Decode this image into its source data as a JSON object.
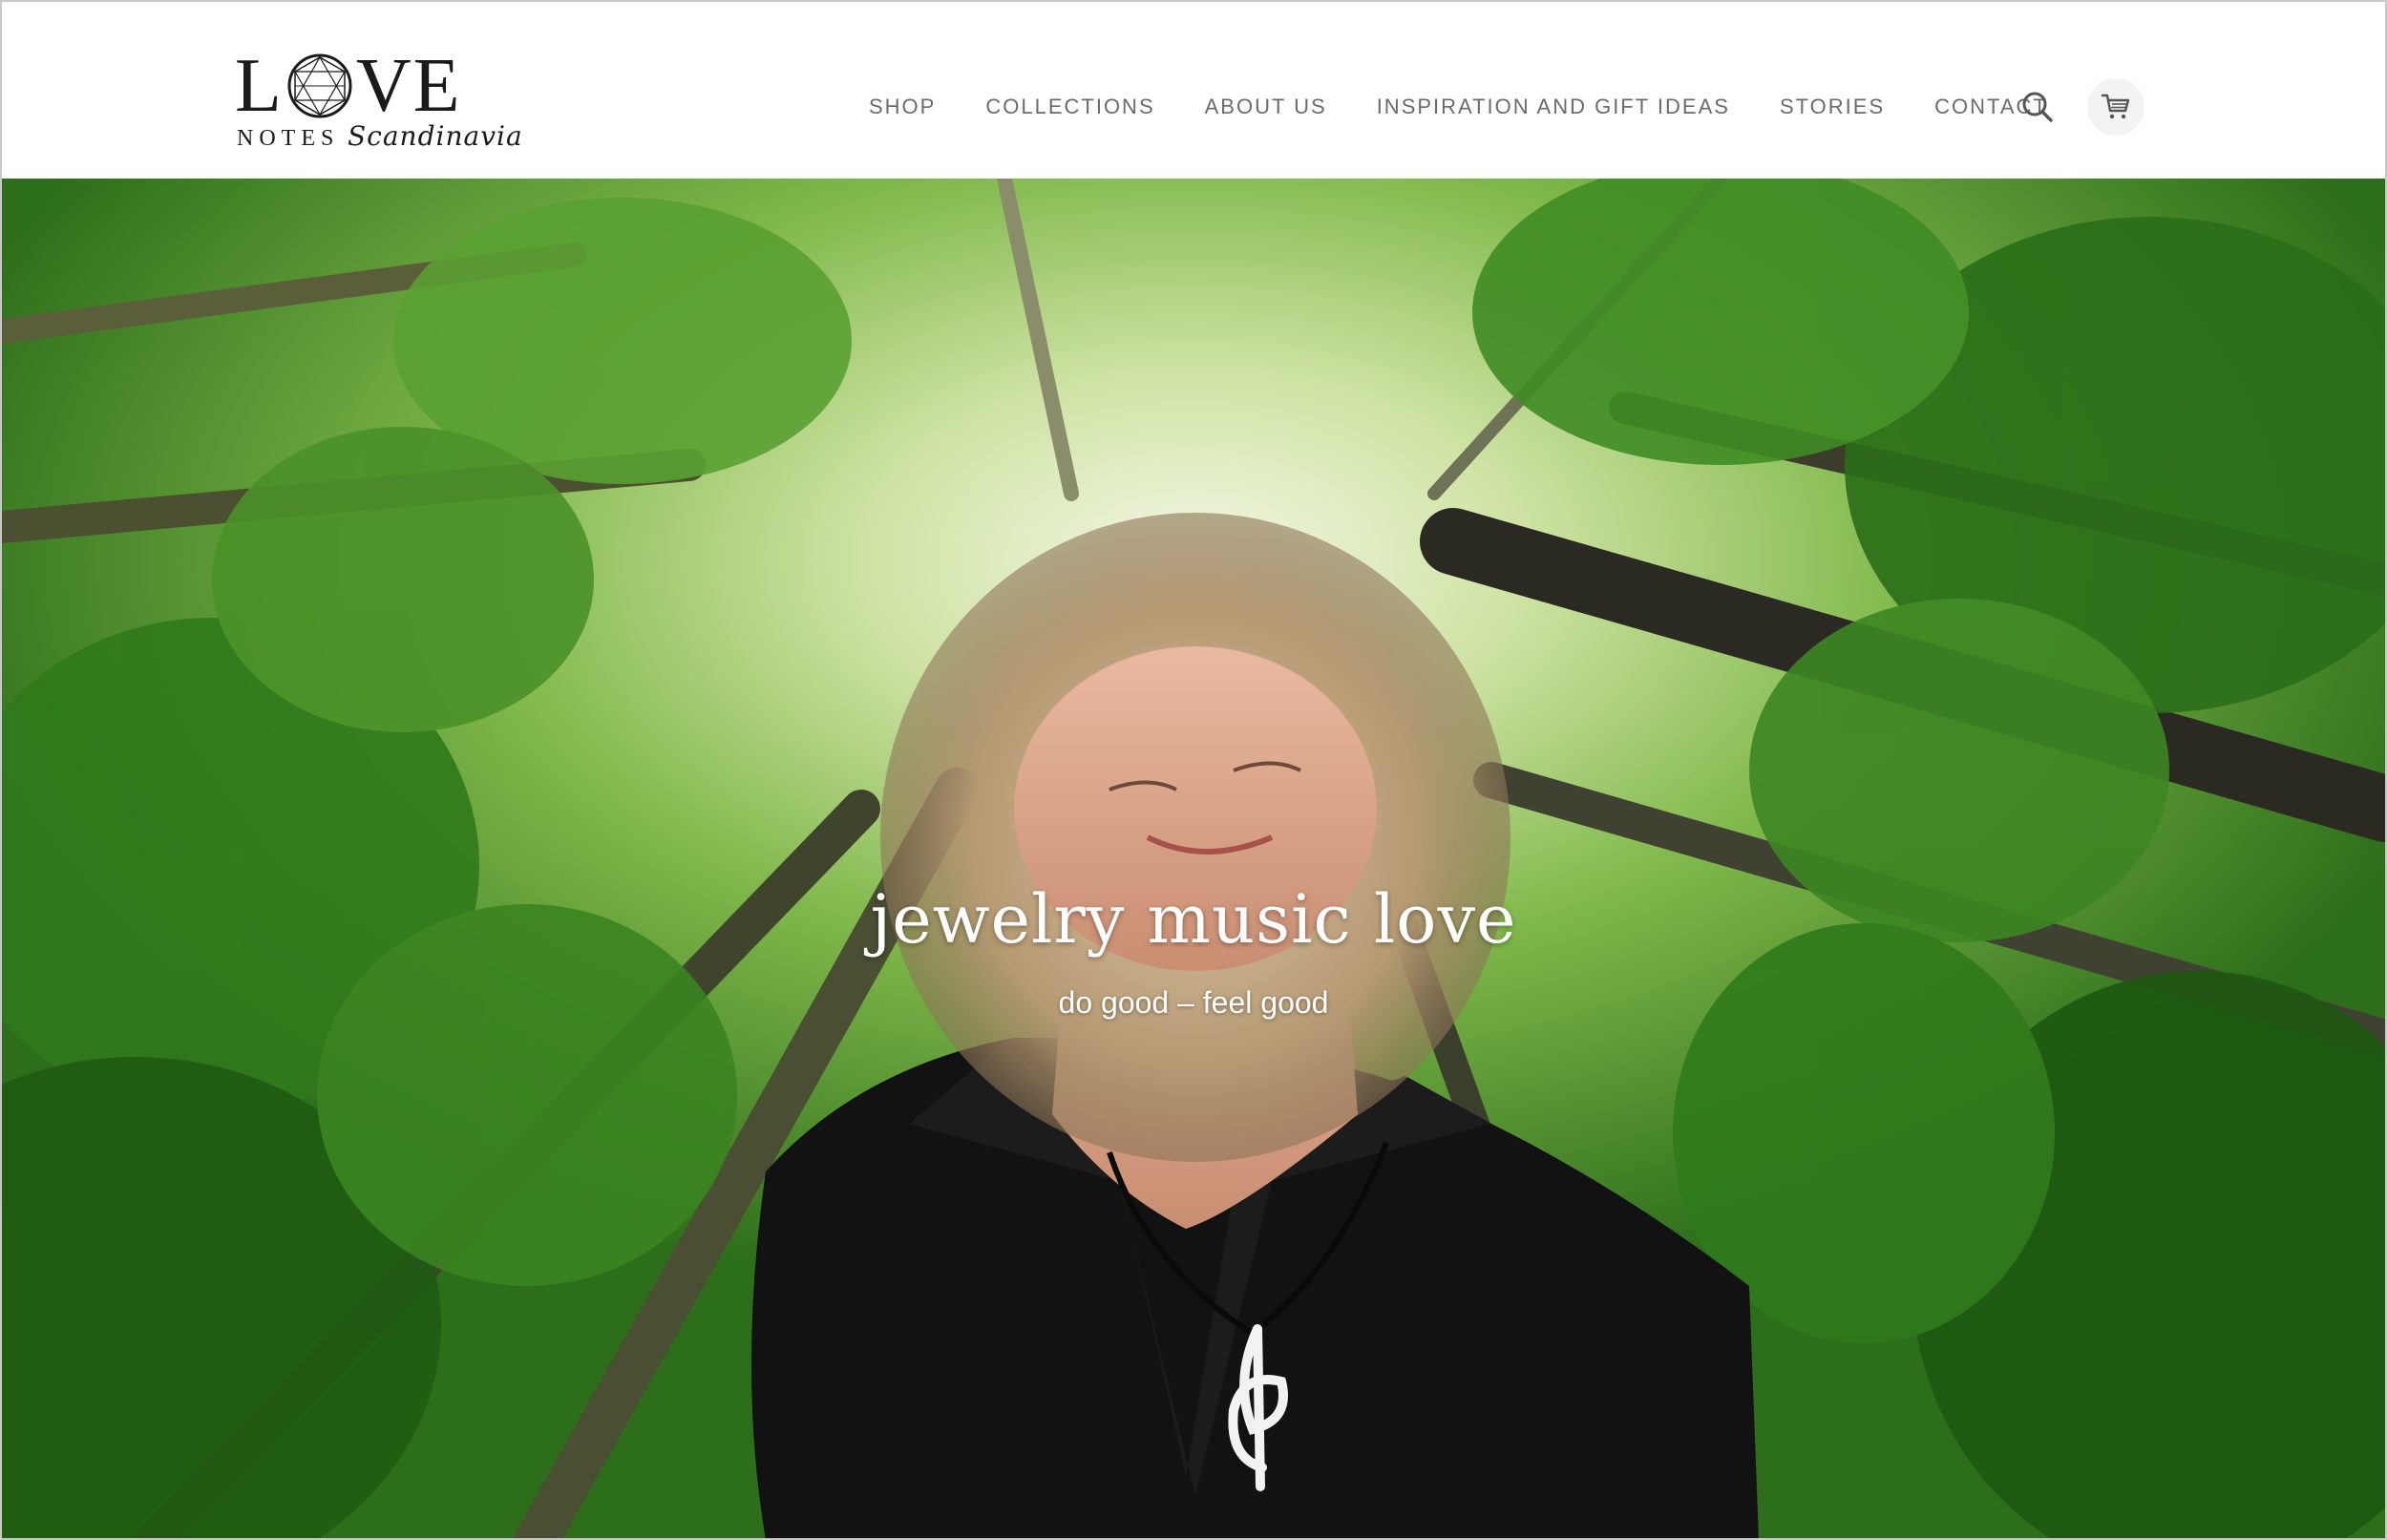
{
  "brand": {
    "logo_main_left": "L",
    "logo_main_right": "VE",
    "logo_notes": "NOTES",
    "logo_script": "Scandinavia"
  },
  "nav": {
    "items": [
      {
        "label": "SHOP"
      },
      {
        "label": "COLLECTIONS"
      },
      {
        "label": "ABOUT US"
      },
      {
        "label": "INSPIRATION AND GIFT IDEAS"
      },
      {
        "label": "STORIES"
      },
      {
        "label": "CONTACT"
      }
    ],
    "search_icon": "search-icon",
    "cart_icon": "cart-icon"
  },
  "hero": {
    "title": "jewelry music love",
    "subtitle": "do good – feel good"
  },
  "colors": {
    "nav_text": "#6b6b6b",
    "logo": "#1a1a1a",
    "hero_text": "#ffffff",
    "foliage": "#3f8a24"
  }
}
